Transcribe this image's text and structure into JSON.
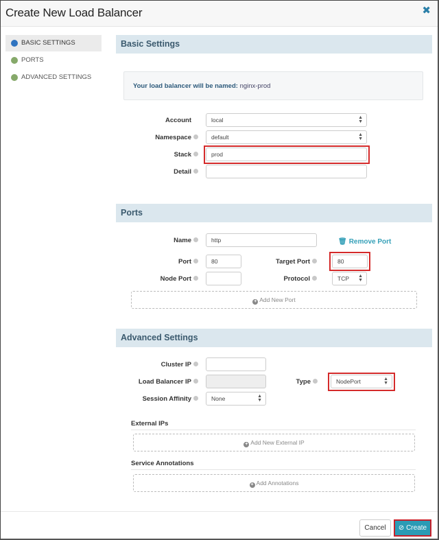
{
  "dialog": {
    "title": "Create New Load Balancer",
    "close_icon": "close-icon"
  },
  "sidebar": {
    "items": [
      {
        "label": "BASIC SETTINGS",
        "active": true,
        "dot_color": "#2f74c0"
      },
      {
        "label": "PORTS",
        "active": false,
        "dot_color": "#86a96a"
      },
      {
        "label": "ADVANCED SETTINGS",
        "active": false,
        "dot_color": "#86a96a"
      }
    ]
  },
  "basic": {
    "heading": "Basic Settings",
    "banner_label": "Your load balancer will be named:",
    "banner_value": "nginx-prod",
    "account_label": "Account",
    "account_value": "local",
    "namespace_label": "Namespace",
    "namespace_value": "default",
    "stack_label": "Stack",
    "stack_value": "prod",
    "detail_label": "Detail",
    "detail_value": ""
  },
  "ports": {
    "heading": "Ports",
    "name_label": "Name",
    "name_value": "http",
    "remove_label": "Remove Port",
    "port_label": "Port",
    "port_value": "80",
    "target_port_label": "Target Port",
    "target_port_value": "80",
    "node_port_label": "Node Port",
    "node_port_value": "",
    "protocol_label": "Protocol",
    "protocol_value": "TCP",
    "add_label": "Add New Port"
  },
  "advanced": {
    "heading": "Advanced Settings",
    "cluster_ip_label": "Cluster IP",
    "cluster_ip_value": "",
    "lb_ip_label": "Load Balancer IP",
    "lb_ip_value": "",
    "type_label": "Type",
    "type_value": "NodePort",
    "session_affinity_label": "Session Affinity",
    "session_affinity_value": "None",
    "external_ips_label": "External IPs",
    "add_external_ip_label": "Add New External IP",
    "annotations_label": "Service Annotations",
    "add_annotations_label": "Add Annotations"
  },
  "footer": {
    "cancel_label": "Cancel",
    "create_label": "Create"
  },
  "colors": {
    "accent": "#2b9bb5",
    "section_header_bg": "#dbe7ee",
    "highlight": "#d42a2a"
  }
}
